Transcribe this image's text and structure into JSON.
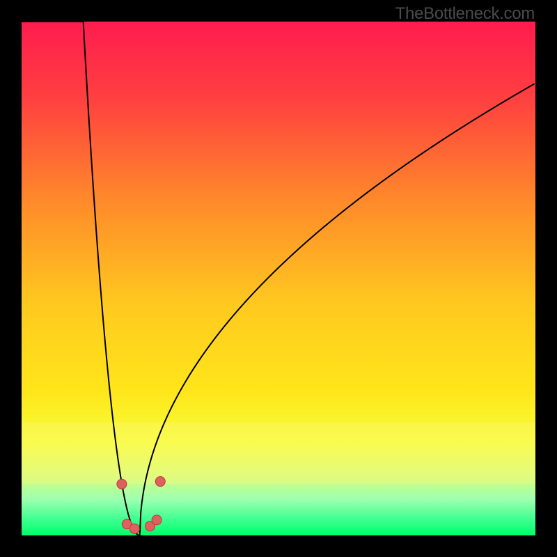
{
  "watermark": "TheBottleneck.com",
  "chart_data": {
    "type": "line",
    "title": "",
    "xlabel": "",
    "ylabel": "",
    "xlim": [
      0,
      100
    ],
    "ylim": [
      0,
      100
    ],
    "curve": {
      "name": "bottleneck",
      "x_min_at": 23,
      "left_branch_top_x": 12,
      "right_branch_top_y": 88
    },
    "markers": [
      {
        "x": 19.5,
        "y": 10.0
      },
      {
        "x": 27.0,
        "y": 10.5
      },
      {
        "x": 20.5,
        "y": 2.2
      },
      {
        "x": 22.0,
        "y": 1.3
      },
      {
        "x": 25.0,
        "y": 1.8
      },
      {
        "x": 26.3,
        "y": 3.0
      }
    ],
    "gradient_stops": [
      {
        "offset": 0.0,
        "color": "#ff1c4e"
      },
      {
        "offset": 0.15,
        "color": "#ff4040"
      },
      {
        "offset": 0.35,
        "color": "#ff8a2a"
      },
      {
        "offset": 0.55,
        "color": "#ffc91f"
      },
      {
        "offset": 0.72,
        "color": "#ffe61a"
      },
      {
        "offset": 0.82,
        "color": "#f6ff3a"
      },
      {
        "offset": 0.88,
        "color": "#d6ff7a"
      },
      {
        "offset": 0.93,
        "color": "#9dffb0"
      },
      {
        "offset": 0.97,
        "color": "#3bff8f"
      },
      {
        "offset": 1.0,
        "color": "#00ff66"
      }
    ],
    "pale_band": {
      "y0": 0.78,
      "y1": 0.9,
      "color": "#fff37a",
      "opacity": 0.35
    }
  }
}
